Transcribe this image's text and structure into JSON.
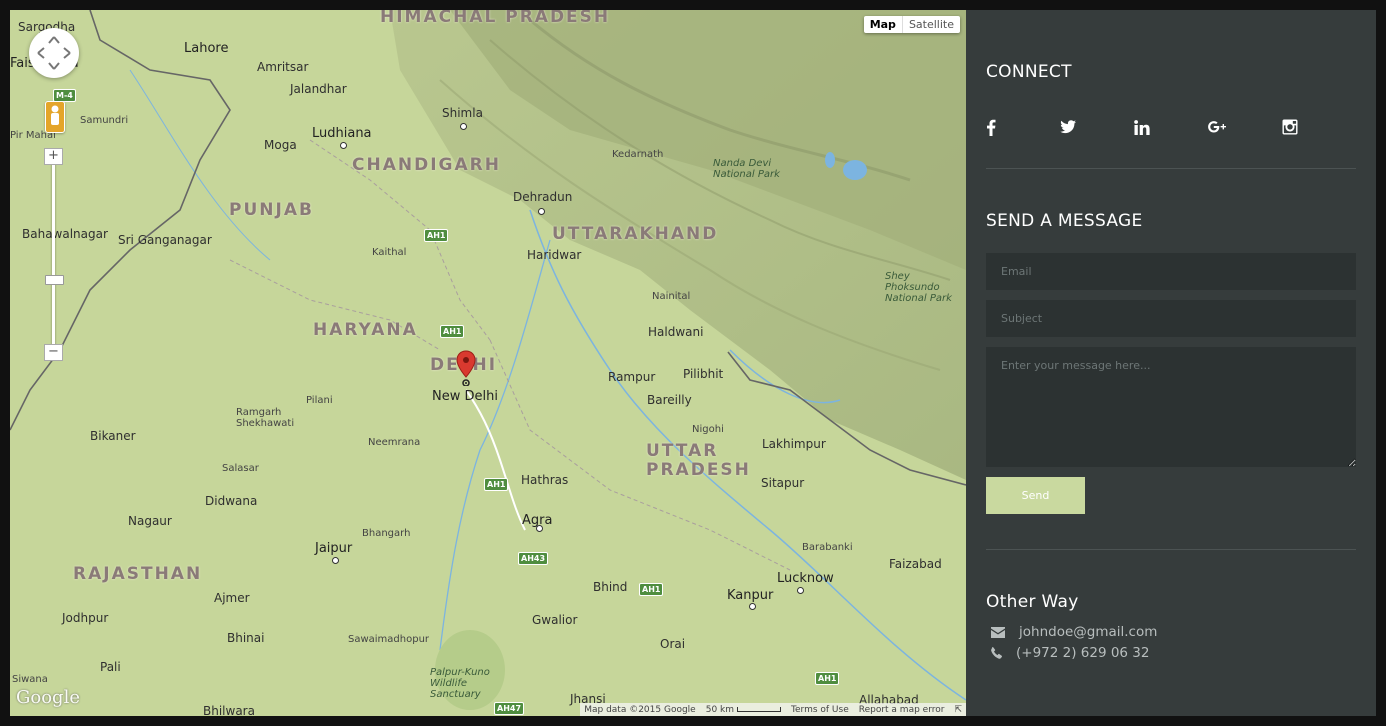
{
  "map": {
    "controls": {
      "map_label": "Map",
      "satellite_label": "Satellite",
      "zoom_in": "+",
      "zoom_out": "−"
    },
    "logo": "Google",
    "attribution": {
      "data": "Map data ©2015 Google",
      "scale": "50 km",
      "terms": "Terms of Use",
      "report": "Report a map error"
    },
    "marker_label": "New Delhi",
    "regions": [
      "HIMACHAL PRADESH",
      "CHANDIGARH",
      "PUNJAB",
      "UTTARAKHAND",
      "HARYANA",
      "DELHI",
      "UTTAR PRADESH",
      "RAJASTHAN"
    ],
    "cities": [
      "Sargodha",
      "Faisalabad",
      "Lahore",
      "Amritsar",
      "Jalandhar",
      "Samundri",
      "Pir Mahal",
      "Ludhiana",
      "Moga",
      "Shimla",
      "Dehradun",
      "Haridwar",
      "Kaithal",
      "Bahawalnagar",
      "Sri Ganganagar",
      "Nainital",
      "Haldwani",
      "Rampur",
      "Pilibhit",
      "Bareilly",
      "Pilani",
      "Ramgarh Shekhawati",
      "Bikaner",
      "Neemrana",
      "Nigohi",
      "Lakhimpur",
      "Salasar",
      "Hathras",
      "Sitapur",
      "Didwana",
      "Agra",
      "Nagaur",
      "Jaipur",
      "Bhangarh",
      "Barabanki",
      "Faizabad",
      "Lucknow",
      "Ajmer",
      "Bhind",
      "Kanpur",
      "Jodhpur",
      "Gwalior",
      "Bhinai",
      "Sawaimadhopur",
      "Orai",
      "Pali",
      "Palpur-Kuno Wildlife Sanctuary",
      "Siwana",
      "Bhilwara",
      "Jhansi",
      "Allahabad",
      "Kedarnath",
      "Nanda Devi National Park",
      "Shey Phoksundo National Park"
    ],
    "highways": [
      "M-4",
      "AH1",
      "AH1",
      "AH1",
      "AH43",
      "AH1",
      "AH1",
      "AH47"
    ]
  },
  "sidebar": {
    "connect_heading": "CONNECT",
    "social": [
      "facebook-icon",
      "twitter-icon",
      "linkedin-icon",
      "google-plus-icon",
      "instagram-icon"
    ],
    "message_heading": "SEND A MESSAGE",
    "email_placeholder": "Email",
    "subject_placeholder": "Subject",
    "message_placeholder": "Enter your message here...",
    "send_label": "Send",
    "other_heading": "Other Way",
    "email": "johndoe@gmail.com",
    "phone": "(+972 2) 629 06 32"
  },
  "colors": {
    "sidebar_bg": "#363c3c",
    "field_bg": "#2c3232",
    "send_bg": "#c9d99f",
    "map_land": "#c6d69a"
  }
}
